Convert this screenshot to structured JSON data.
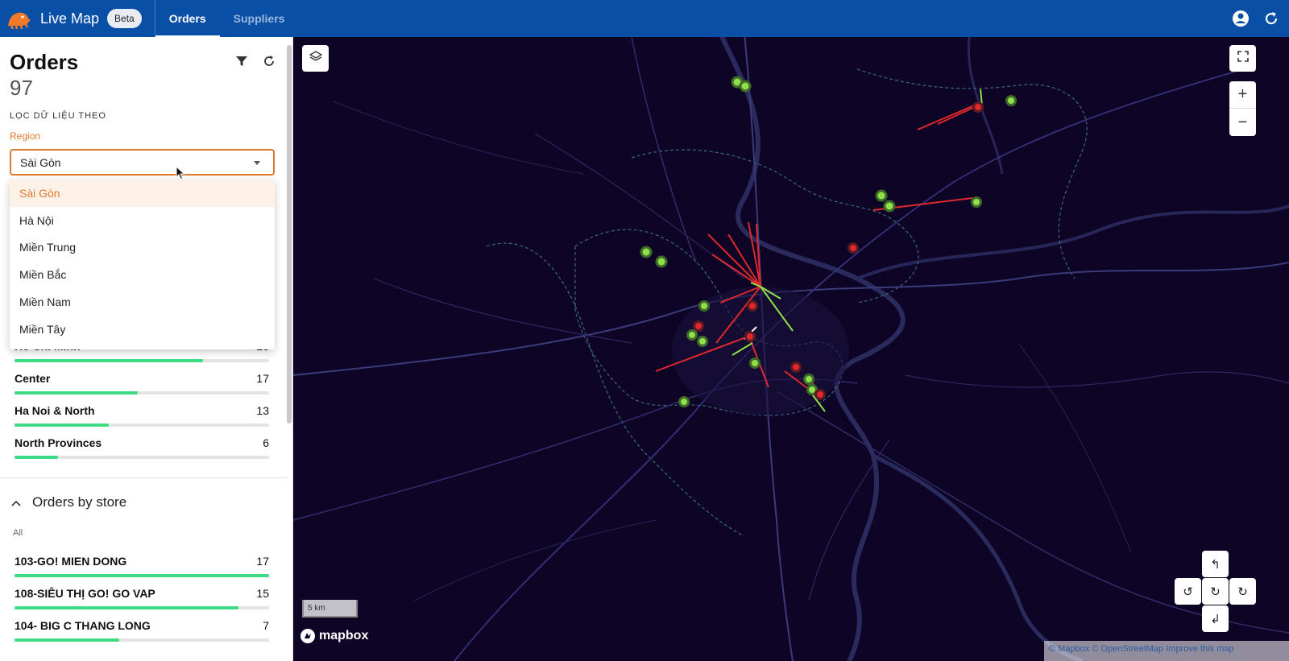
{
  "header": {
    "app_title": "Live Map",
    "badge": "Beta",
    "tabs": [
      {
        "label": "Orders",
        "active": true
      },
      {
        "label": "Suppliers",
        "active": false
      }
    ],
    "icons": [
      "account-circle-icon",
      "refresh-icon"
    ],
    "brand_color": "#0a4fa6"
  },
  "sidebar": {
    "title": "Orders",
    "count": "97",
    "filter_heading": "LỌC DỮ LIỆU THEO",
    "region_label": "Region",
    "region_value": "Sài Gòn",
    "region_options": [
      "Sài Gòn",
      "Hà Nội",
      "Miền Trung",
      "Miền Bắc",
      "Miền Nam",
      "Miền Tây"
    ],
    "regions": [
      {
        "name": "Ho Chi Minh",
        "value": "25",
        "fraction": 0.74
      },
      {
        "name": "Center",
        "value": "17",
        "fraction": 0.485
      },
      {
        "name": "Ha Noi & North",
        "value": "13",
        "fraction": 0.37
      },
      {
        "name": "North Provinces",
        "value": "6",
        "fraction": 0.17
      }
    ],
    "store_section_title": "Orders by store",
    "store_filter": "All",
    "stores": [
      {
        "name": "103-GO! MIEN DONG",
        "value": "17",
        "fraction": 1.0
      },
      {
        "name": "108-SIÊU THỊ GO! GO VAP",
        "value": "15",
        "fraction": 0.88
      },
      {
        "name": "104- BIG C THANG LONG",
        "value": "7",
        "fraction": 0.41
      }
    ],
    "accent_color": "#e07a2c",
    "bar_color": "#3ddc84"
  },
  "map": {
    "scale_label": "5 km",
    "provider": "mapbox",
    "attribution": "© Mapbox © OpenStreetMap Improve this map",
    "controls": [
      "layers-icon",
      "fullscreen-icon",
      "zoom-in",
      "zoom-out",
      "rotate-controls"
    ],
    "zoom_in_label": "+",
    "zoom_out_label": "−",
    "background_color": "#0e0425"
  }
}
